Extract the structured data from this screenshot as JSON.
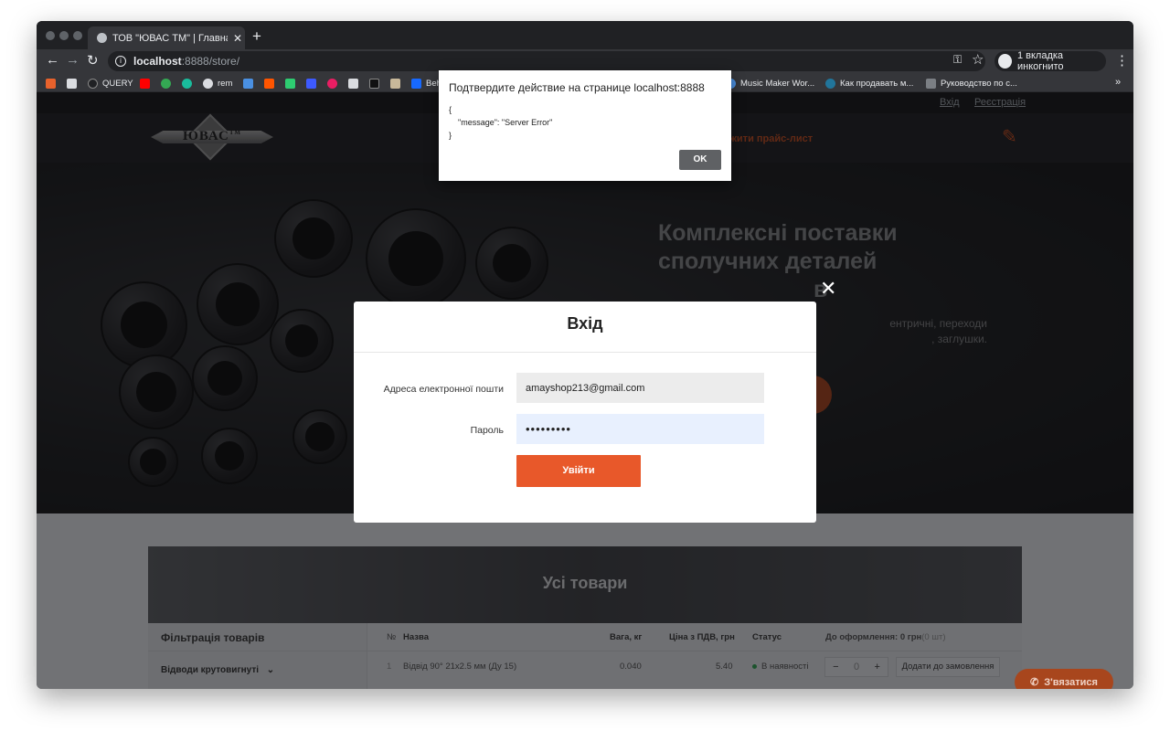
{
  "browser": {
    "tab_title": "ТОВ \"ЮВАС ТМ\" | Главная стр",
    "url_host": "localhost",
    "url_path": ":8888/store/",
    "incognito_label": "1 вкладка инкогнито",
    "bookmarks": [
      {
        "label": "",
        "color": "#e8622c"
      },
      {
        "label": "",
        "color": "#dadce0"
      },
      {
        "label": "QUERY",
        "color": "#202124"
      },
      {
        "label": "",
        "color": "#ff0000"
      },
      {
        "label": "",
        "color": "#34a853"
      },
      {
        "label": "",
        "color": "#1abc9c"
      },
      {
        "label": "rem",
        "color": "#dadce0"
      },
      {
        "label": "",
        "color": "#4a90e2"
      },
      {
        "label": "",
        "color": "#ff5500"
      },
      {
        "label": "",
        "color": "#2ecc71"
      },
      {
        "label": "",
        "color": "#3d5afe"
      },
      {
        "label": "",
        "color": "#e91e63"
      },
      {
        "label": "",
        "color": "#dadce0"
      },
      {
        "label": "",
        "color": "#111111"
      },
      {
        "label": "",
        "color": "#c8b89a"
      },
      {
        "label": "Beh",
        "color": "#1769ff"
      },
      {
        "label": "Music Maker Wor...",
        "color": "#4a90e2"
      },
      {
        "label": "Как продавать м...",
        "color": "#21759b"
      },
      {
        "label": "Руководство по с...",
        "color": "#7b7f84"
      }
    ],
    "more_label": "»"
  },
  "site": {
    "login_link": "Вхід",
    "register_link": "Реєстрація",
    "logo_text": "ЮВАС",
    "logo_tm": "ТМ",
    "price_link": "ажити прайс-лист",
    "hero_title": "Комплексні поставки сполучних деталей",
    "hero_title_tail": "в",
    "hero_sub_1": "ентричні, переходи",
    "hero_sub_2": ", заглушки.",
    "products_title": "Усі товари",
    "filter_title": "Фільтрація товарів",
    "filter_category": "Відводи крутовигнуті",
    "table_headers": {
      "num": "№",
      "name": "Назва",
      "weight": "Вага, кг",
      "price": "Ціна з ПДВ, грн",
      "status": "Статус",
      "order_prefix": "До оформлення: 0 грн",
      "order_suffix": "(0 шт)"
    },
    "row": {
      "num": "1",
      "name": "Відвід 90° 21х2.5 мм (Ду 15)",
      "weight": "0.040",
      "price": "5.40",
      "status": "В наявності",
      "qty": "0",
      "minus": "−",
      "plus": "+",
      "add_button": "Додати до замовлення"
    },
    "contact_button": "З'вязатися"
  },
  "login_modal": {
    "title": "Вхід",
    "email_label": "Адреса електронної пошти",
    "email_value": "amayshop213@gmail.com",
    "password_label": "Пароль",
    "password_value": "•••••••••",
    "submit_label": "Увійти"
  },
  "alert": {
    "title": "Подтвердите действие на странице localhost:8888",
    "body": "{\n    \"message\": \"Server Error\"\n}",
    "ok_label": "OK"
  }
}
